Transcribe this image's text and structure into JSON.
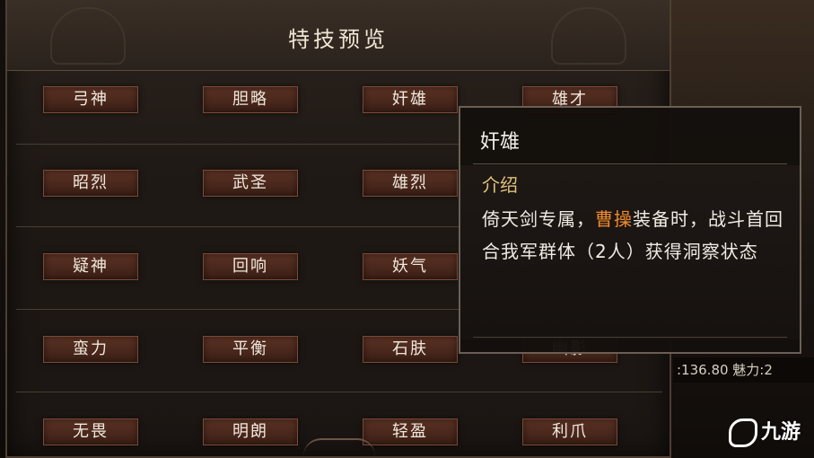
{
  "panel": {
    "title": "特技预览"
  },
  "skills": [
    [
      "弓神",
      "胆略",
      "奸雄",
      "雄才"
    ],
    [
      "昭烈",
      "武圣",
      "雄烈",
      ""
    ],
    [
      "疑神",
      "回响",
      "妖气",
      ""
    ],
    [
      "蛮力",
      "平衡",
      "石肤",
      "幽影"
    ],
    [
      "无畏",
      "明朗",
      "轻盈",
      "利爪"
    ]
  ],
  "tooltip": {
    "title": "奸雄",
    "section": "介绍",
    "text_before": "倚天剑专属，",
    "highlight": "曹操",
    "text_after": "装备时，战斗首回合我军群体（2人）获得洞察状态",
    "highlight_color": "#f08a2c"
  },
  "background": {
    "stat_text": ":136.80 魅力:2"
  },
  "logo": {
    "text": "九游"
  }
}
